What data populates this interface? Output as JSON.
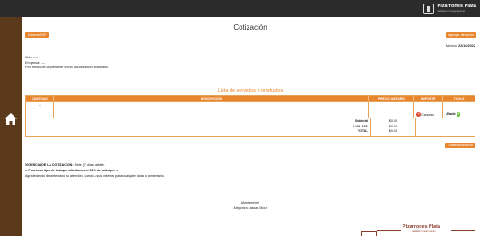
{
  "brand": {
    "name": "Pizarrones Plata",
    "slogan": "Calidad al mejor precio"
  },
  "sidebar": {
    "icon": "home-icon"
  },
  "page": {
    "title": "Cotización"
  },
  "buttons": {
    "generate_pdf": "GenerarPDF",
    "add_address": "Agregar dirección",
    "edit_accessories": "Editar accesorios"
  },
  "date": {
    "prefix": "México,",
    "value": "22/10/2022"
  },
  "letter": {
    "attn": "Attn: ----",
    "company": "Empresa: ----",
    "intro": "Por medio de la presente envío la cotización solicitada."
  },
  "list": {
    "title": "Lista de servicios o productos",
    "columns": [
      "CANTIDAD",
      "DESCRIPCIÓN",
      "PRECIO UNITARIO",
      "IMPORTE",
      "TOOLS"
    ],
    "row": {
      "quantity": "--",
      "cancel_label": "Cancelar",
      "add_label": "Añadir"
    }
  },
  "totals": {
    "subtotal_label": "Subtotal",
    "subtotal_value": "$0.00",
    "iva_label": "I.V.A 16%",
    "iva_value": "$0.00",
    "total_label": "TOTAL",
    "total_value": "$0.00"
  },
  "terms": {
    "validity_label": "VIGENCIA DE LA COTIZACION:",
    "validity_value": "Siete (7) días hábiles.",
    "advance": "-- Para todo tipo de trabajo solicitamos el 60% de anticipo. --",
    "thanks": "Agradeciendo de antemano su atención, quedo a sus órdenes para cualquier duda o comentario."
  },
  "signature": {
    "closing": "Atentamente",
    "name": "Alejandra Lassart Mora"
  },
  "colors": {
    "accent": "#e8862f",
    "sidebar": "#5b3a1b",
    "topbar": "#2b2b2b",
    "footer_brand": "#8b3a2e"
  }
}
